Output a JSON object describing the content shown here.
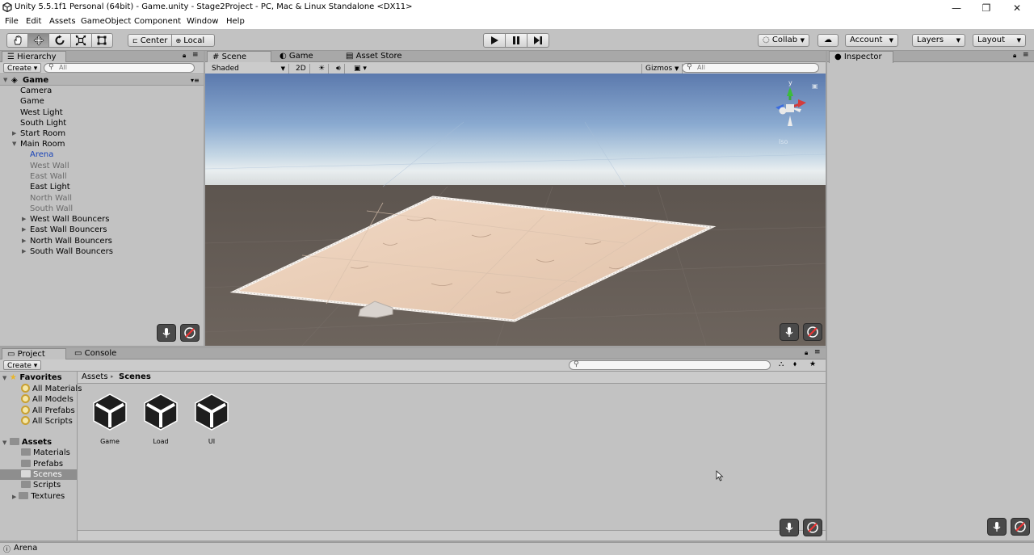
{
  "window": {
    "title": "Unity 5.5.1f1 Personal (64bit) - Game.unity - Stage2Project - PC, Mac & Linux Standalone <DX11>",
    "minimize": "—",
    "maximize": "❐",
    "close": "✕"
  },
  "menu": [
    "File",
    "Edit",
    "Assets",
    "GameObject",
    "Component",
    "Window",
    "Help"
  ],
  "toolbar": {
    "tools": [
      "hand-tool-icon",
      "move-tool-icon",
      "rotate-tool-icon",
      "scale-tool-icon",
      "rect-tool-icon"
    ],
    "pivot": "Center",
    "space": "Local",
    "collab": "Collab",
    "account": "Account",
    "layers": "Layers",
    "layout": "Layout"
  },
  "hierarchy": {
    "tab": "Hierarchy",
    "create": "Create",
    "search_placeholder": "All",
    "scene_name": "Game",
    "items": [
      {
        "label": "Camera"
      },
      {
        "label": "Game"
      },
      {
        "label": "West Light"
      },
      {
        "label": "South Light"
      },
      {
        "label": "Start Room"
      },
      {
        "label": "Main Room"
      },
      {
        "label": "Arena"
      },
      {
        "label": "West Wall"
      },
      {
        "label": "East Wall"
      },
      {
        "label": "East Light"
      },
      {
        "label": "North Wall"
      },
      {
        "label": "South Wall"
      },
      {
        "label": "West Wall Bouncers"
      },
      {
        "label": "East Wall Bouncers"
      },
      {
        "label": "North Wall Bouncers"
      },
      {
        "label": "South Wall Bouncers"
      }
    ]
  },
  "scene_view": {
    "tabs": [
      "Scene",
      "Game",
      "Asset Store"
    ],
    "shading": "Shaded",
    "mode_2d": "2D",
    "gizmos": "Gizmos",
    "search_placeholder": "All",
    "gizmo_label": "Iso",
    "axis_y": "y"
  },
  "inspector": {
    "tab": "Inspector"
  },
  "project": {
    "tabs": [
      "Project",
      "Console"
    ],
    "create": "Create",
    "favorites_label": "Favorites",
    "favorites": [
      "All Materials",
      "All Models",
      "All Prefabs",
      "All Scripts"
    ],
    "assets_label": "Assets",
    "folders": [
      "Materials",
      "Prefabs",
      "Scenes",
      "Scripts",
      "Textures"
    ],
    "breadcrumb": [
      "Assets",
      "Scenes"
    ],
    "assets": [
      "Game",
      "Load",
      "UI"
    ]
  },
  "status": {
    "text": "Arena"
  },
  "colors": {
    "selection": "#3d80df",
    "accent_blue": "#1a44b8"
  }
}
